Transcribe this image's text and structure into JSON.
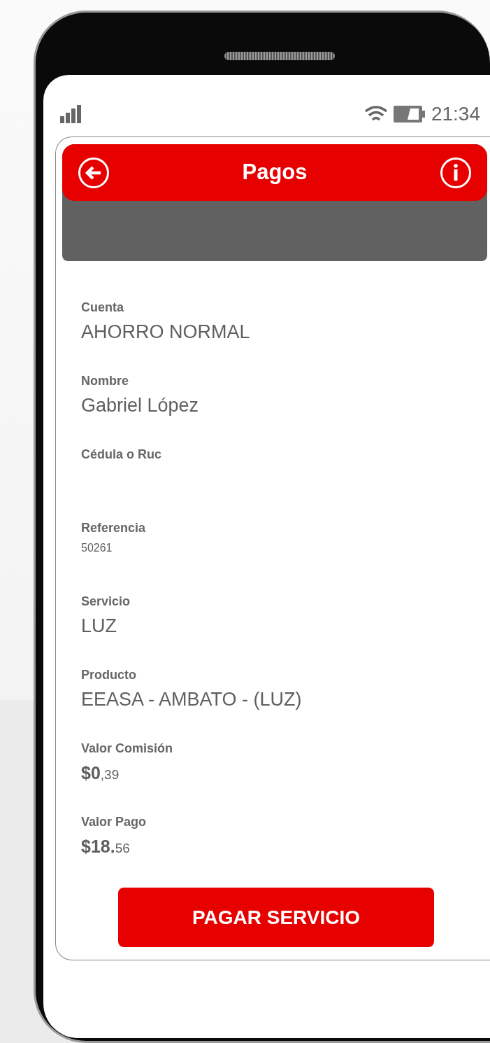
{
  "status_bar": {
    "time": "21:34"
  },
  "header": {
    "title": "Pagos"
  },
  "fields": [
    {
      "kind": "text",
      "label": "Cuenta",
      "value": "AHORRO NORMAL"
    },
    {
      "kind": "text",
      "label": "Nombre",
      "value": "Gabriel López"
    },
    {
      "kind": "empty",
      "label": "Cédula o Ruc"
    },
    {
      "kind": "small",
      "label": "Referencia",
      "value": "50261"
    },
    {
      "kind": "text",
      "label": "Servicio",
      "value": "LUZ"
    },
    {
      "kind": "text",
      "label": "Producto",
      "value": "EEASA - AMBATO - (LUZ)"
    },
    {
      "kind": "amount",
      "label": "Valor Comisión",
      "whole": "$0",
      "fraction": ",39"
    },
    {
      "kind": "amount",
      "label": "Valor Pago",
      "whole": "$18.",
      "fraction": "56"
    }
  ],
  "button": {
    "label": "PAGAR SERVICIO"
  }
}
